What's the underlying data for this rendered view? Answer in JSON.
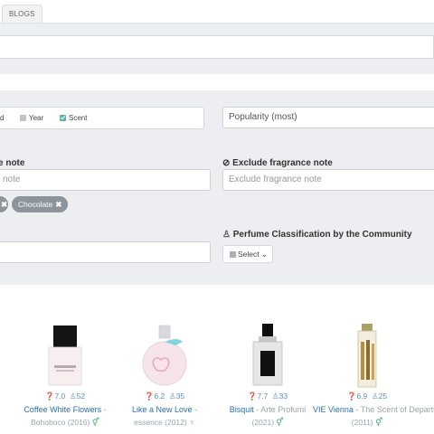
{
  "tabs": {
    "blogs": "BLOGS"
  },
  "filters": {
    "checkboxes": [
      {
        "label": "d",
        "checked": false
      },
      {
        "label": "Year",
        "checked": false
      },
      {
        "label": "Scent",
        "checked": true
      }
    ],
    "sort_value": "Popularity (most)",
    "include_note": {
      "heading": "e note",
      "placeholder": "note"
    },
    "exclude_note": {
      "heading": "Exclude fragrance note",
      "placeholder": "Exclude fragrance note"
    },
    "selected_notes": [
      {
        "label": "Chocolate",
        "remove": "✖"
      }
    ],
    "classification": {
      "heading": "Perfume Classification by the Community",
      "select_label": "Select"
    }
  },
  "results": [
    {
      "rating": "7.0",
      "votes": "52",
      "name": "Coffee White Flowers",
      "sep": " -",
      "brand": "Bohoboco",
      "year": "(2016)",
      "gender": "unisex"
    },
    {
      "rating": "6.2",
      "votes": "35",
      "name": "Like a New Love",
      "sep": " -",
      "brand": "essence",
      "year": "(2012)",
      "gender": "female"
    },
    {
      "rating": "7.7",
      "votes": "33",
      "name": "Bisquit",
      "sep": " - ",
      "brand": "Arte Profumi",
      "year": "(2021)",
      "gender": "unisex"
    },
    {
      "rating": "6.9",
      "votes": "25",
      "name": "VIE Vienna",
      "sep": " - ",
      "brand": "The Scent of Departure",
      "year": "(2011)",
      "gender": "unisex"
    }
  ],
  "colors": {
    "accent": "#2a6db3",
    "panel_bg": "#eceef1",
    "pill": "#8c949c",
    "check": "#5ab4a6",
    "unisex": "#3fae62",
    "female": "#e0609b"
  }
}
